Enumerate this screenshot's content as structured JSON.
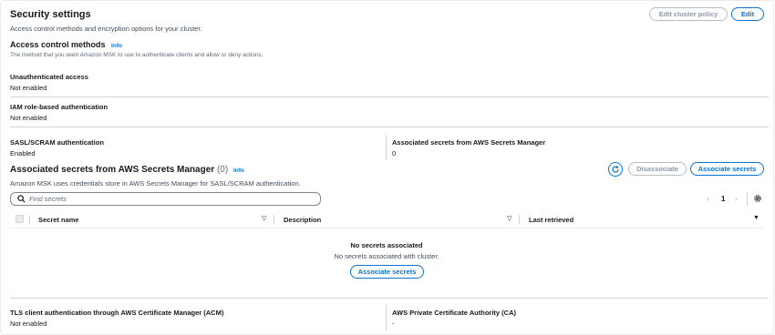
{
  "header": {
    "title": "Security settings",
    "description": "Access control methods and encryption options for your cluster.",
    "edit_cluster_policy_label": "Edit cluster policy",
    "edit_label": "Edit"
  },
  "access_control": {
    "title": "Access control methods",
    "info_label": "Info",
    "description": "The method that you want Amazon MSK to use to authenticate clients and allow or deny actions."
  },
  "unauthenticated": {
    "label": "Unauthenticated access",
    "value": "Not enabled"
  },
  "iam": {
    "label": "IAM role-based authentication",
    "value": "Not enabled"
  },
  "sasl": {
    "label": "SASL/SCRAM authentication",
    "value": "Enabled"
  },
  "assoc_summary": {
    "label": "Associated secrets from AWS Secrets Manager",
    "value": "0"
  },
  "secrets_section": {
    "title": "Associated secrets from AWS Secrets Manager",
    "count": "(0)",
    "info_label": "Info",
    "description": "Amazon MSK uses credentials store in AWS Secrets Manager for SASL/SCRAM authentication.",
    "disassociate_label": "Disassociate",
    "associate_label": "Associate secrets",
    "search_placeholder": "Find secrets",
    "page_number": "1",
    "columns": [
      "Secret name",
      "Description",
      "Last retrieved"
    ],
    "empty_title": "No secrets associated",
    "empty_description": "No secrets associated with cluster.",
    "empty_button_label": "Associate secrets"
  },
  "tls": {
    "label": "TLS client authentication through AWS Certificate Manager (ACM)",
    "value": "Not enabled"
  },
  "private_ca": {
    "label": "AWS Private Certificate Authority (CA)",
    "value": "-"
  },
  "colors": {
    "accent": "#0972d3",
    "text": "#16191f",
    "disabled": "#8d99a8"
  }
}
